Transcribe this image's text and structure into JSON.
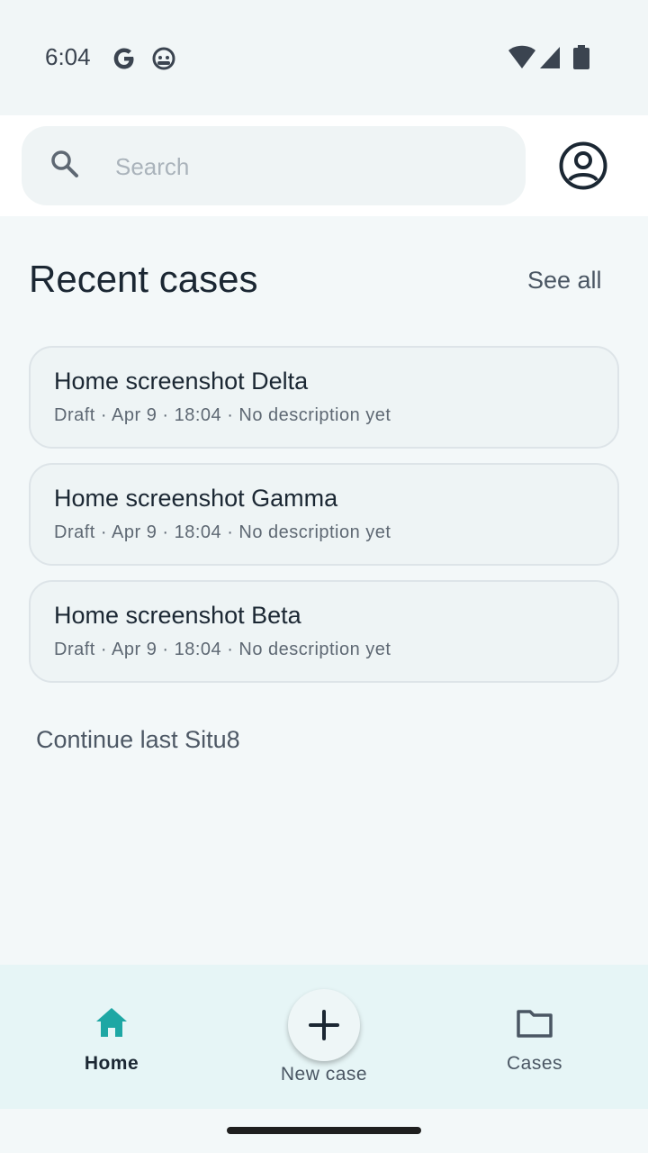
{
  "status_bar": {
    "time": "6:04",
    "icons_left": [
      "google-g-icon",
      "android-debug-icon"
    ],
    "icons_right": [
      "wifi-icon",
      "signal-icon",
      "battery-icon"
    ]
  },
  "search": {
    "placeholder": "Search",
    "value": ""
  },
  "recent": {
    "title": "Recent cases",
    "see_all_label": "See all",
    "cases": [
      {
        "title": "Home screenshot Delta",
        "meta": "Draft · Apr 9 · 18:04 · No description yet"
      },
      {
        "title": "Home screenshot Gamma",
        "meta": "Draft · Apr 9 · 18:04 · No description yet"
      },
      {
        "title": "Home screenshot Beta",
        "meta": "Draft · Apr 9 · 18:04 · No description yet"
      }
    ]
  },
  "continue_label": "Continue last Situ8",
  "bottom_nav": {
    "home_label": "Home",
    "new_case_label": "New case",
    "cases_label": "Cases",
    "active": "Home"
  },
  "colors": {
    "accent": "#1ea7a4",
    "text_primary": "#1b2733",
    "nav_background": "#e6f5f6",
    "card_background": "#eef4f5"
  }
}
